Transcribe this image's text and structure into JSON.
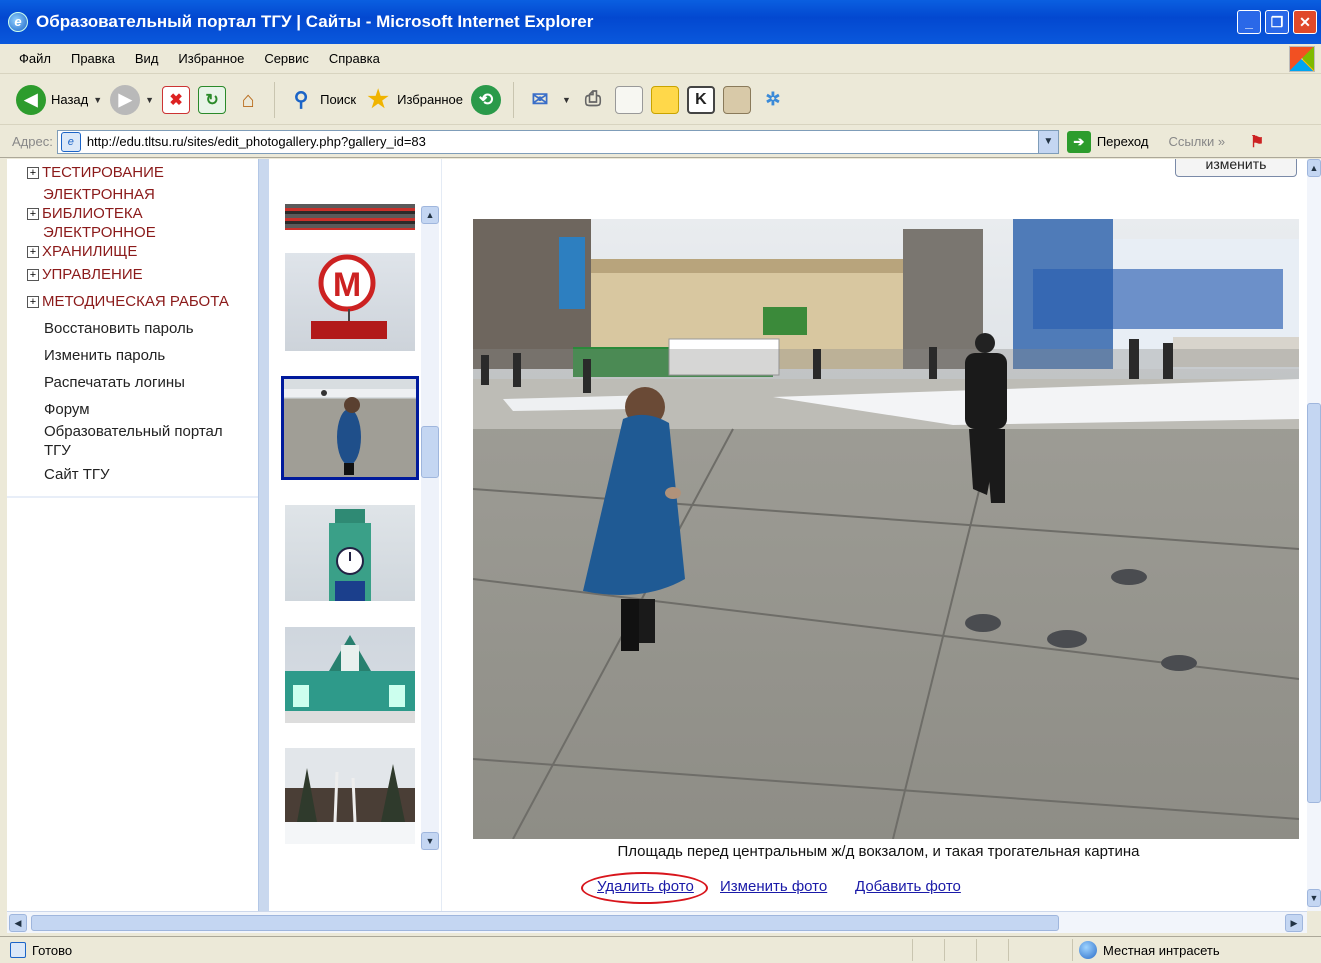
{
  "window": {
    "title": "Образовательный портал ТГУ | Сайты - Microsoft Internet Explorer"
  },
  "menu": [
    "Файл",
    "Правка",
    "Вид",
    "Избранное",
    "Сервис",
    "Справка"
  ],
  "toolbar": {
    "back": "Назад",
    "search": "Поиск",
    "favorites": "Избранное"
  },
  "address": {
    "label": "Адрес:",
    "url": "http://edu.tltsu.ru/sites/edit_photogallery.php?gallery_id=83",
    "go": "Переход",
    "links": "Ссылки"
  },
  "sidebar": {
    "sections": [
      {
        "line1": "ТЕСТИРОВАНИЕ",
        "line2": ""
      },
      {
        "line1": "ЭЛЕКТРОННАЯ",
        "line2": "БИБЛИОТЕКА"
      },
      {
        "line1": "ЭЛЕКТРОННОЕ",
        "line2": "ХРАНИЛИЩЕ"
      },
      {
        "line1": "УПРАВЛЕНИЕ",
        "line2": ""
      },
      {
        "line1": "МЕТОДИЧЕСКАЯ РАБОТА",
        "line2": ""
      }
    ],
    "links": [
      {
        "line1": "Восстановить пароль",
        "line2": ""
      },
      {
        "line1": "Изменить пароль",
        "line2": ""
      },
      {
        "line1": "Распечатать логины",
        "line2": ""
      },
      {
        "line1": "Форум",
        "line2": ""
      },
      {
        "line1": "Образовательный портал",
        "line2": "ТГУ"
      },
      {
        "line1": "Сайт ТГУ",
        "line2": ""
      }
    ]
  },
  "main": {
    "top_button": "изменить",
    "caption": "Площадь перед центральным ж/д вокзалом, и такая трогательная картина",
    "actions": {
      "delete": "Удалить фото",
      "edit": "Изменить фото",
      "add": "Добавить фото"
    }
  },
  "status": {
    "text": "Готово",
    "zone": "Местная интрасеть"
  },
  "colors": {
    "title_bar": "#0348d0",
    "nav_text": "#8b1a1a",
    "link": "#1a1aa8",
    "highlight_oval": "#d8151c",
    "selected_thumb": "#001a9c"
  }
}
